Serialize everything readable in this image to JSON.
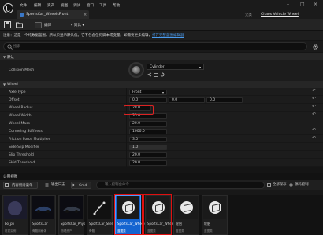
{
  "menu": [
    "文件",
    "编辑",
    "资产",
    "视图",
    "调试",
    "窗口",
    "工具",
    "帮助"
  ],
  "tab": {
    "label": "SportsCar_WheelsFront",
    "close": "×"
  },
  "parent": {
    "label": "父类",
    "link": "Chaos Vehicle Wheel"
  },
  "toolbar": {
    "compile": "编译",
    "diff": "▾ 对比 ▾"
  },
  "info": {
    "text": "注意：这是一个纯数据蓝图，所以只显示默认值。它不包含任何脚本或变量。如需要更多编辑，",
    "link": "打开完整蓝图编辑器"
  },
  "search": {
    "placeholder": "搜索"
  },
  "sections": {
    "defaults": "默认",
    "wheel": "Wheel"
  },
  "collision": {
    "label": "Collision Mesh",
    "value": "Cylinder"
  },
  "props": [
    {
      "label": "Axle Type",
      "value": "Front",
      "kind": "combo"
    },
    {
      "label": "Offset",
      "values": [
        "0.0",
        "0.0",
        "0.0"
      ],
      "kind": "vec"
    },
    {
      "label": "Wheel Radius",
      "value": "28.0",
      "kind": "num"
    },
    {
      "label": "Wheel Width",
      "value": "35.0",
      "kind": "num"
    },
    {
      "label": "Wheel Mass",
      "value": "20.0",
      "kind": "num"
    },
    {
      "label": "Cornering Stiffness",
      "value": "1000.0",
      "kind": "num"
    },
    {
      "label": "Friction Force Multiplier",
      "value": "3.0",
      "kind": "num"
    },
    {
      "label": "Side Slip Modifier",
      "value": "1.0",
      "kind": "slider"
    },
    {
      "label": "Slip Threshold",
      "value": "20.0",
      "kind": "num"
    },
    {
      "label": "Skid Threshold",
      "value": "20.0",
      "kind": "num"
    }
  ],
  "bottom": {
    "title": "内容侧滑菜单",
    "import": "导入",
    "add": "内容侧滑菜单",
    "export_label": "输出日志",
    "cmd": "Cmd",
    "console_placeholder": "输入控制台命令",
    "save_all": "全部保存",
    "source_control": "源码控制",
    "path_label": "公用视图"
  },
  "assets": [
    {
      "name": "bo_ph",
      "type": "材质实例",
      "selected": false
    },
    {
      "name": "SportsCar",
      "type": "骨骼网格体",
      "selected": false
    },
    {
      "name": "SportsCar_Phys",
      "type": "物理资产",
      "selected": false
    },
    {
      "name": "SportsCar_Skel",
      "type": "骨骼",
      "selected": false
    },
    {
      "name": "SportsCar_WheelsFront",
      "type": "蓝图类",
      "selected": true
    },
    {
      "name": "SportsCar_WheelsRear",
      "type": "蓝图类",
      "selected": false
    },
    {
      "name": "轮胎",
      "type": "蓝图类",
      "selected": false
    },
    {
      "name": "轮胎",
      "type": "蓝图类",
      "selected": false
    }
  ]
}
